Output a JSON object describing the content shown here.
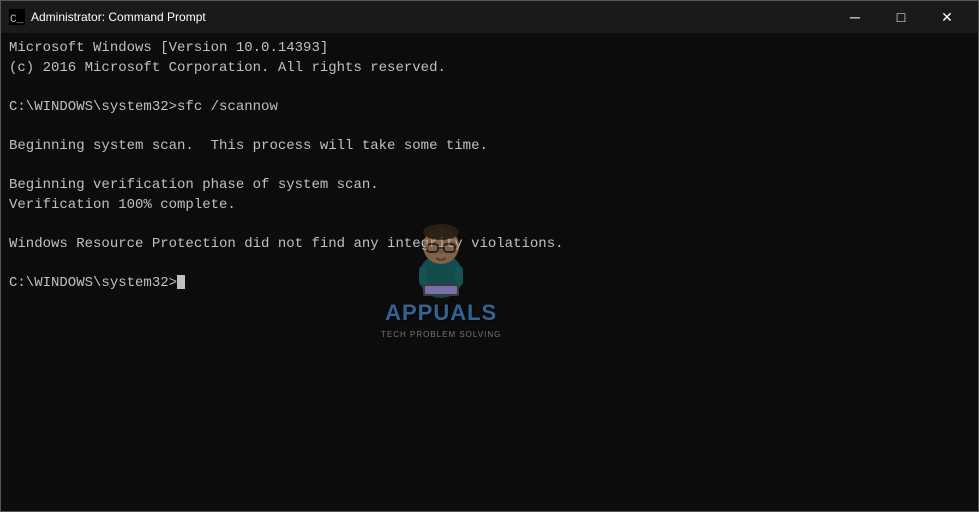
{
  "window": {
    "title": "Administrator: Command Prompt",
    "icon": "cmd-icon"
  },
  "controls": {
    "minimize": "─",
    "maximize": "□",
    "close": "✕"
  },
  "console": {
    "lines": [
      "Microsoft Windows [Version 10.0.14393]",
      "(c) 2016 Microsoft Corporation. All rights reserved.",
      "",
      "C:\\WINDOWS\\system32>sfc /scannow",
      "",
      "Beginning system scan.  This process will take some time.",
      "",
      "Beginning verification phase of system scan.",
      "Verification 100% complete.",
      "",
      "Windows Resource Protection did not find any integrity violations.",
      "",
      "C:\\WINDOWS\\system32>"
    ]
  },
  "colors": {
    "bg": "#0c0c0c",
    "text": "#c0c0c0",
    "titlebar": "#1a1a1a"
  }
}
